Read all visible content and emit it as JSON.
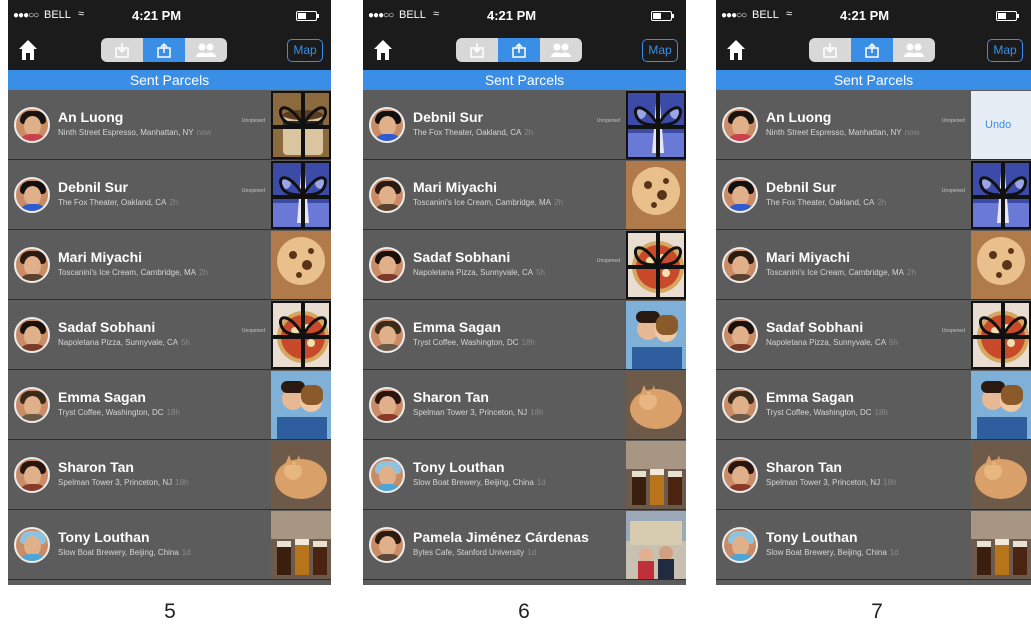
{
  "status_bar": {
    "signal": "●●●○○",
    "carrier": "BELL",
    "wifi": "≈",
    "time": "4:21 PM"
  },
  "nav": {
    "map_label": "Map"
  },
  "screens": [
    {
      "label": "5",
      "title": "Sent Parcels",
      "rows": [
        {
          "name": "An Luong",
          "location": "Ninth Street Espresso, Manhattan, NY",
          "ago": "now",
          "status": "Unopened",
          "wrapped": true,
          "thumb": "coffee"
        },
        {
          "name": "Debnil Sur",
          "location": "The Fox Theater, Oakland, CA",
          "ago": "2h",
          "status": "Unopened",
          "wrapped": true,
          "thumb": "theater"
        },
        {
          "name": "Mari Miyachi",
          "location": "Toscanini's Ice Cream, Cambridge, MA",
          "ago": "2h",
          "status": "",
          "wrapped": false,
          "thumb": "cookie"
        },
        {
          "name": "Sadaf Sobhani",
          "location": "Napoletana Pizza, Sunnyvale, CA",
          "ago": "5h",
          "status": "Unopened",
          "wrapped": true,
          "thumb": "pizza"
        },
        {
          "name": "Emma Sagan",
          "location": "Tryst Coffee, Washington, DC",
          "ago": "18h",
          "status": "",
          "wrapped": false,
          "thumb": "couple"
        },
        {
          "name": "Sharon Tan",
          "location": "Spelman Tower 3, Princeton, NJ",
          "ago": "18h",
          "status": "",
          "wrapped": false,
          "thumb": "cat"
        },
        {
          "name": "Tony Louthan",
          "location": "Slow Boat Brewery, Beijing, China",
          "ago": "1d",
          "status": "",
          "wrapped": false,
          "thumb": "beer"
        }
      ]
    },
    {
      "label": "6",
      "title": "Sent Parcels",
      "rows": [
        {
          "name": "Debnil Sur",
          "location": "The Fox Theater, Oakland, CA",
          "ago": "2h",
          "status": "Unopened",
          "wrapped": true,
          "thumb": "theater"
        },
        {
          "name": "Mari Miyachi",
          "location": "Toscanini's Ice Cream, Cambridge, MA",
          "ago": "2h",
          "status": "",
          "wrapped": false,
          "thumb": "cookie"
        },
        {
          "name": "Sadaf Sobhani",
          "location": "Napoletana Pizza, Sunnyvale, CA",
          "ago": "5h",
          "status": "Unopened",
          "wrapped": true,
          "thumb": "pizza"
        },
        {
          "name": "Emma Sagan",
          "location": "Tryst Coffee, Washington, DC",
          "ago": "18h",
          "status": "",
          "wrapped": false,
          "thumb": "couple"
        },
        {
          "name": "Sharon Tan",
          "location": "Spelman Tower 3, Princeton, NJ",
          "ago": "18h",
          "status": "",
          "wrapped": false,
          "thumb": "cat"
        },
        {
          "name": "Tony Louthan",
          "location": "Slow Boat Brewery, Beijing, China",
          "ago": "1d",
          "status": "",
          "wrapped": false,
          "thumb": "beer"
        },
        {
          "name": "Pamela Jiménez Cárdenas",
          "location": "Bytes Cafe, Stanford University",
          "ago": "1d",
          "status": "",
          "wrapped": false,
          "thumb": "campus"
        }
      ]
    },
    {
      "label": "7",
      "title": "Sent Parcels",
      "rows": [
        {
          "name": "An Luong",
          "location": "Ninth Street Espresso, Manhattan, NY",
          "ago": "now",
          "status": "Unopened",
          "wrapped": false,
          "thumb": "undo",
          "undo_label": "Undo"
        },
        {
          "name": "Debnil Sur",
          "location": "The Fox Theater, Oakland, CA",
          "ago": "2h",
          "status": "Unopened",
          "wrapped": true,
          "thumb": "theater"
        },
        {
          "name": "Mari Miyachi",
          "location": "Toscanini's Ice Cream, Cambridge, MA",
          "ago": "2h",
          "status": "",
          "wrapped": false,
          "thumb": "cookie"
        },
        {
          "name": "Sadaf Sobhani",
          "location": "Napoletana Pizza, Sunnyvale, CA",
          "ago": "5h",
          "status": "Unopened",
          "wrapped": true,
          "thumb": "pizza"
        },
        {
          "name": "Emma Sagan",
          "location": "Tryst Coffee, Washington, DC",
          "ago": "18h",
          "status": "",
          "wrapped": false,
          "thumb": "couple"
        },
        {
          "name": "Sharon Tan",
          "location": "Spelman Tower 3, Princeton, NJ",
          "ago": "18h",
          "status": "",
          "wrapped": false,
          "thumb": "cat"
        },
        {
          "name": "Tony Louthan",
          "location": "Slow Boat Brewery, Beijing, China",
          "ago": "1d",
          "status": "",
          "wrapped": false,
          "thumb": "beer"
        }
      ]
    }
  ],
  "colors": {
    "accent": "#3a8ee6",
    "bar": "#1b1b1b",
    "row_bg": "#5c5c5c"
  }
}
